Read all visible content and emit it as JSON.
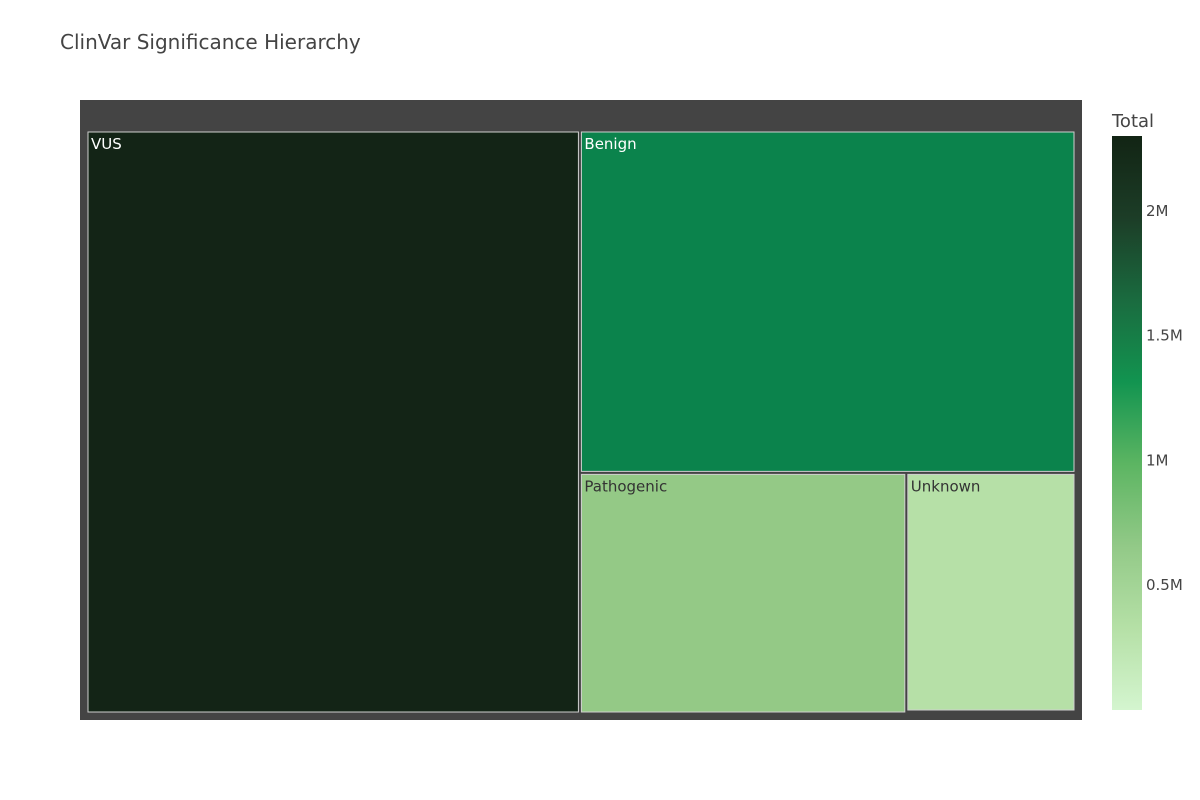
{
  "title": "ClinVar Significance Hierarchy",
  "chart_data": {
    "type": "treemap",
    "title": "ClinVar Significance Hierarchy",
    "colorbar": {
      "title": "Total",
      "range": [
        0,
        2300000
      ],
      "ticks": [
        {
          "value": 500000,
          "label": "0.5M"
        },
        {
          "value": 1000000,
          "label": "1M"
        },
        {
          "value": 1500000,
          "label": "1.5M"
        },
        {
          "value": 2000000,
          "label": "2M"
        }
      ],
      "colors": [
        "#d4f5cf",
        "#b5e0a6",
        "#92c987",
        "#5cb562",
        "#129450",
        "#1a6b3f",
        "#1c3d27",
        "#122414"
      ]
    },
    "border_color": "#444444",
    "tiles": [
      {
        "label": "VUS",
        "value": 2270000,
        "color": "#132416",
        "text_color": "#ffffff"
      },
      {
        "label": "Benign",
        "value": 1340000,
        "color": "#0b834c",
        "text_color": "#ffffff"
      },
      {
        "label": "Pathogenic",
        "value": 620000,
        "color": "#94c986",
        "text_color": "#333333"
      },
      {
        "label": "Unknown",
        "value": 320000,
        "color": "#b6e0a7",
        "text_color": "#333333"
      }
    ]
  }
}
